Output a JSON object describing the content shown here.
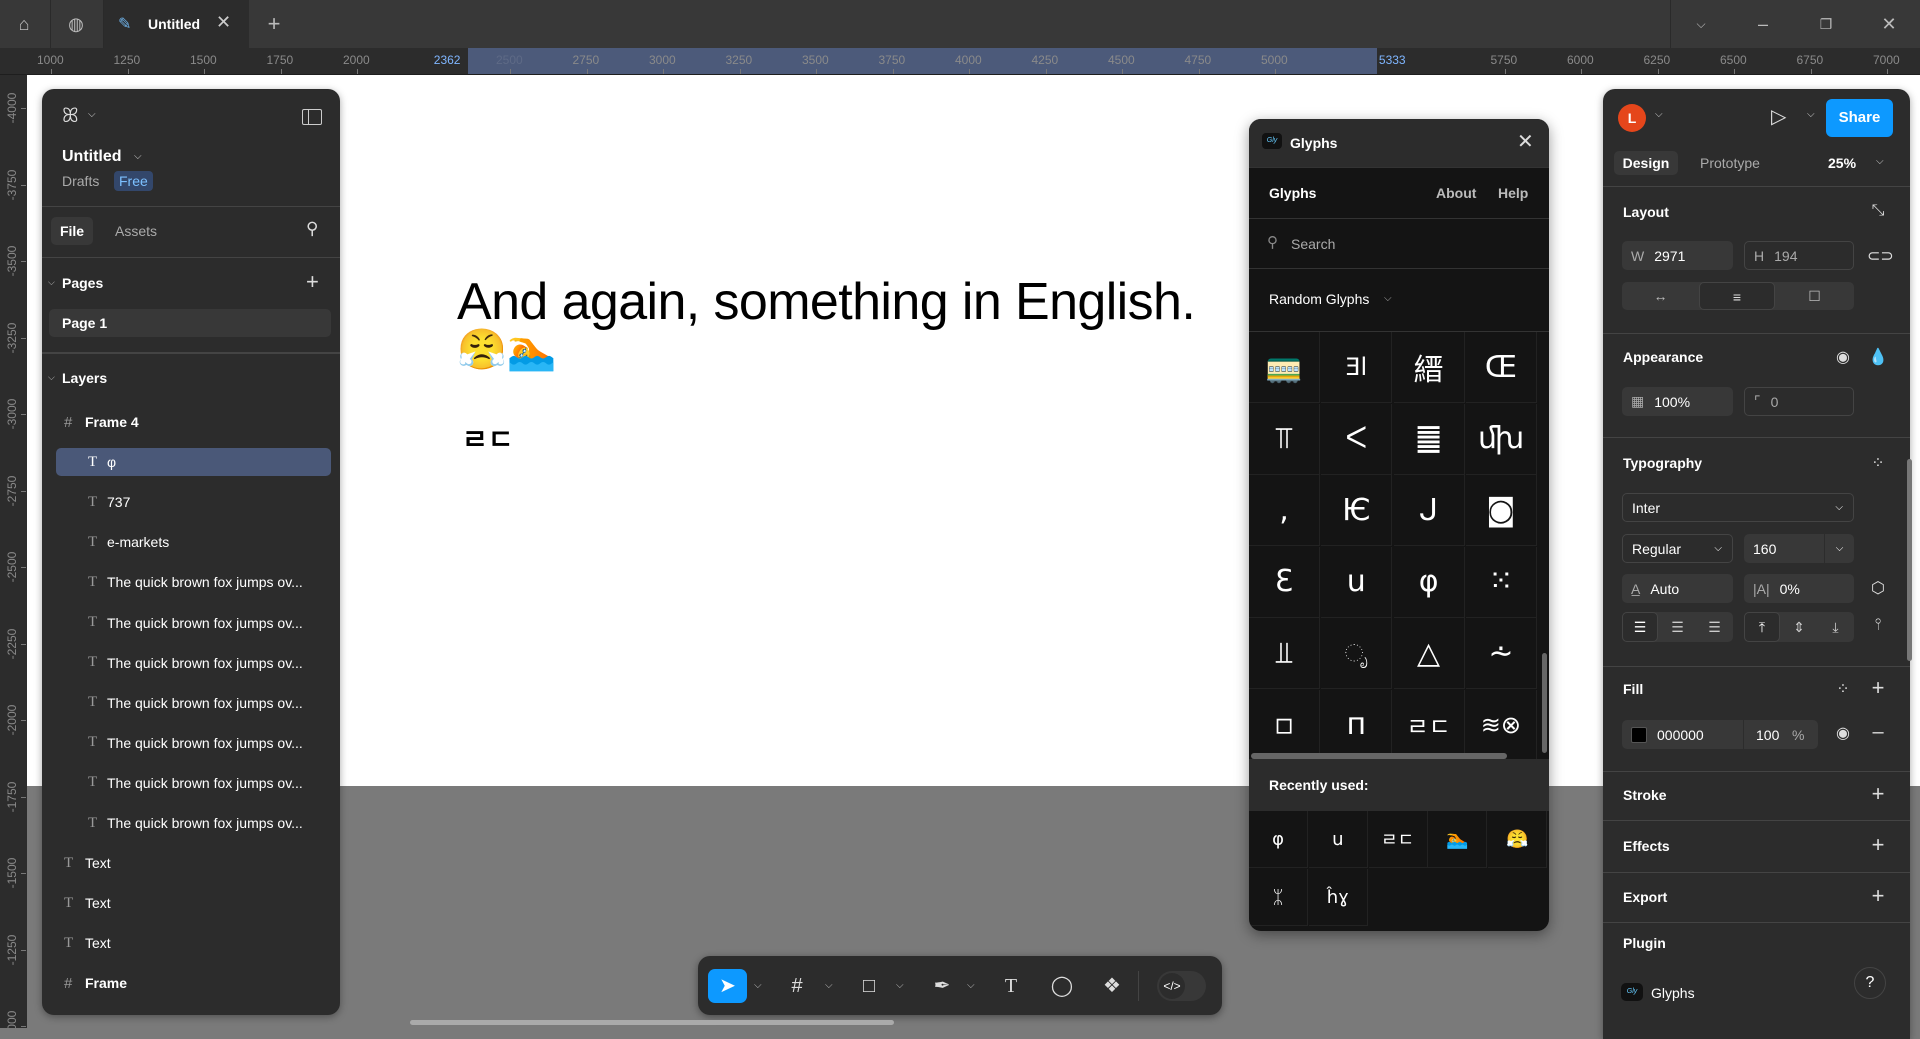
{
  "titlebar": {
    "tab_title": "Untitled",
    "icons": [
      "home-icon",
      "globe-icon",
      "pen-tool-icon",
      "close-icon",
      "plus-icon",
      "chevron-down-icon",
      "minimize-icon",
      "restore-icon",
      "close-window-icon"
    ]
  },
  "rulers": {
    "h_labels": [
      1000,
      1250,
      1500,
      1750,
      2000,
      2362,
      2500,
      2750,
      3000,
      3250,
      3500,
      3750,
      4000,
      4250,
      4500,
      4750,
      5000,
      5333,
      5750,
      6000,
      6250,
      6500,
      6750,
      7000
    ],
    "v_labels": [
      -4000,
      -3750,
      -3500,
      -3250,
      -3000,
      -2750,
      -2500,
      -2250,
      -2000,
      -1750,
      -1500,
      -1250,
      -1000
    ],
    "selection": [
      2362,
      5333
    ],
    "selection_color": "#4c5a7a"
  },
  "left_panel": {
    "file_name": "Untitled",
    "location": "Drafts",
    "plan_badge": "Free",
    "tabs": [
      "File",
      "Assets"
    ],
    "pages_label": "Pages",
    "pages": [
      "Page 1"
    ],
    "layers_label": "Layers",
    "layers": [
      {
        "name": "Frame 4",
        "type": "frame",
        "level": 0
      },
      {
        "name": "φ",
        "type": "text",
        "level": 1,
        "selected": true
      },
      {
        "name": "737",
        "type": "text",
        "level": 1
      },
      {
        "name": "e-markets",
        "type": "text",
        "level": 1
      },
      {
        "name": "The quick brown fox jumps ov...",
        "type": "text",
        "level": 1
      },
      {
        "name": "The quick brown fox jumps ov...",
        "type": "text",
        "level": 1
      },
      {
        "name": "The quick brown fox jumps ov...",
        "type": "text",
        "level": 1
      },
      {
        "name": "The quick brown fox jumps ov...",
        "type": "text",
        "level": 1
      },
      {
        "name": "The quick brown fox jumps ov...",
        "type": "text",
        "level": 1
      },
      {
        "name": "The quick brown fox jumps ov...",
        "type": "text",
        "level": 1
      },
      {
        "name": "The quick brown fox jumps ov...",
        "type": "text",
        "level": 1
      },
      {
        "name": "Text",
        "type": "text",
        "level": 0
      },
      {
        "name": "Text",
        "type": "text",
        "level": 0
      },
      {
        "name": "Text",
        "type": "text",
        "level": 0
      },
      {
        "name": "Frame",
        "type": "frame",
        "level": 0
      }
    ]
  },
  "canvas": {
    "headline": "And again, something in English.",
    "emoji_line": "😤🏊",
    "glyph_text": "ㄹㄷ"
  },
  "glyphs_plugin": {
    "window_title": "Glyphs",
    "nav_title": "Glyphs",
    "about": "About",
    "help": "Help",
    "search_placeholder": "Search",
    "category": "Random Glyphs",
    "grid": [
      "🚃",
      "Ǝl",
      "縉",
      "Œ",
      "⫪",
      "ᐸ",
      "䷀",
      "ﬗ",
      ",",
      "Ѥ",
      "ᒍ",
      "◙",
      "Ɛ",
      "u",
      "φ",
      "⁙",
      "⫫",
      "◌ೃ",
      "△",
      "⩪",
      "▫",
      "п",
      "ㄹㄷ",
      "≋⊗"
    ],
    "recent_label": "Recently used:",
    "recent": [
      "φ",
      "u",
      "ㄹㄷ",
      "🏊",
      "😤",
      "ᛯ",
      "ĥɣ"
    ]
  },
  "right_panel": {
    "avatar_initial": "L",
    "avatar_color": "#e5461b",
    "share": "Share",
    "share_color": "#0d99ff",
    "tabs": [
      "Design",
      "Prototype"
    ],
    "zoom": "25%",
    "layout": {
      "title": "Layout",
      "w_label": "W",
      "w": "2971",
      "h_label": "H",
      "h": "194"
    },
    "appearance": {
      "title": "Appearance",
      "opacity": "100%",
      "radius": "0"
    },
    "typography": {
      "title": "Typography",
      "font": "Inter",
      "weight": "Regular",
      "size": "160",
      "line_height": "Auto",
      "letter_spacing": "0%"
    },
    "fill": {
      "title": "Fill",
      "hex": "000000",
      "opacity": "100",
      "unit": "%",
      "color": "#000000"
    },
    "stroke": "Stroke",
    "effects": "Effects",
    "export": "Export",
    "plugin": {
      "title": "Plugin",
      "name": "Glyphs"
    },
    "help": "?"
  }
}
